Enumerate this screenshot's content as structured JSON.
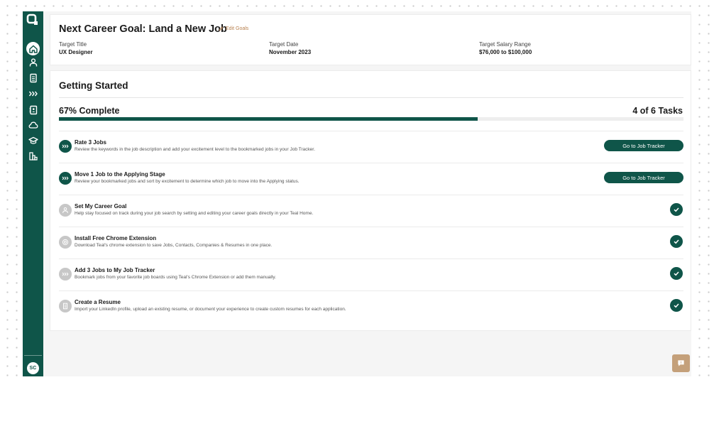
{
  "sidebar": {
    "avatar_initials": "SC",
    "items": [
      {
        "name": "home",
        "icon": "home-icon"
      },
      {
        "name": "profile",
        "icon": "person-icon"
      },
      {
        "name": "resumes",
        "icon": "document-icon"
      },
      {
        "name": "job-tracker",
        "icon": "chevrons-icon"
      },
      {
        "name": "contacts",
        "icon": "contact-book-icon"
      },
      {
        "name": "companies",
        "icon": "cloud-icon"
      },
      {
        "name": "learning",
        "icon": "graduation-cap-icon"
      },
      {
        "name": "analytics",
        "icon": "building-chart-icon"
      }
    ]
  },
  "goal": {
    "title": "Next Career Goal: Land a New Job",
    "edit_label": "Edit Goals",
    "fields": [
      {
        "label": "Target Title",
        "value": "UX Designer"
      },
      {
        "label": "Target Date",
        "value": "November 2023"
      },
      {
        "label": "Target Salary Range",
        "value": "$76,000 to $100,000"
      }
    ]
  },
  "getting_started": {
    "title": "Getting Started",
    "percent_label": "67% Complete",
    "progress_fraction": 0.67,
    "tasks_label": "4 of 6 Tasks",
    "tasks": [
      {
        "title": "Rate 3 Jobs",
        "description": "Review the keywords in the job description and add your excitement level to the bookmarked jobs in your Job Tracker.",
        "status": "todo",
        "icon": "chevrons-icon",
        "button": "Go to Job Tracker"
      },
      {
        "title": "Move 1 Job to the Applying Stage",
        "description": "Review your bookmarked jobs and sort by excitement to determine which job to move into the Applying status.",
        "status": "todo",
        "icon": "chevrons-icon",
        "button": "Go to Job Tracker"
      },
      {
        "title": "Set My Career Goal",
        "description": "Help stay focused on track during your job search by setting and editing your career goals directly in your Teal Home.",
        "status": "done",
        "icon": "person-icon"
      },
      {
        "title": "Install Free Chrome Extension",
        "description": "Download Teal's chrome extension to save Jobs, Contacts, Companies & Resumes in one place.",
        "status": "done",
        "icon": "chrome-icon"
      },
      {
        "title": "Add 3 Jobs to My Job Tracker",
        "description": "Bookmark jobs from your favorite job boards using Teal's Chrome Extension or add them manually.",
        "status": "done",
        "icon": "chevrons-icon"
      },
      {
        "title": "Create a Resume",
        "description": "Import your LinkedIn profile, upload an existing resume, or document your experience to create custom resumes for each application.",
        "status": "done",
        "icon": "document-icon"
      }
    ]
  },
  "colors": {
    "brand": "#0f5549",
    "accent": "#b8814f",
    "chat": "#c4a07a"
  }
}
